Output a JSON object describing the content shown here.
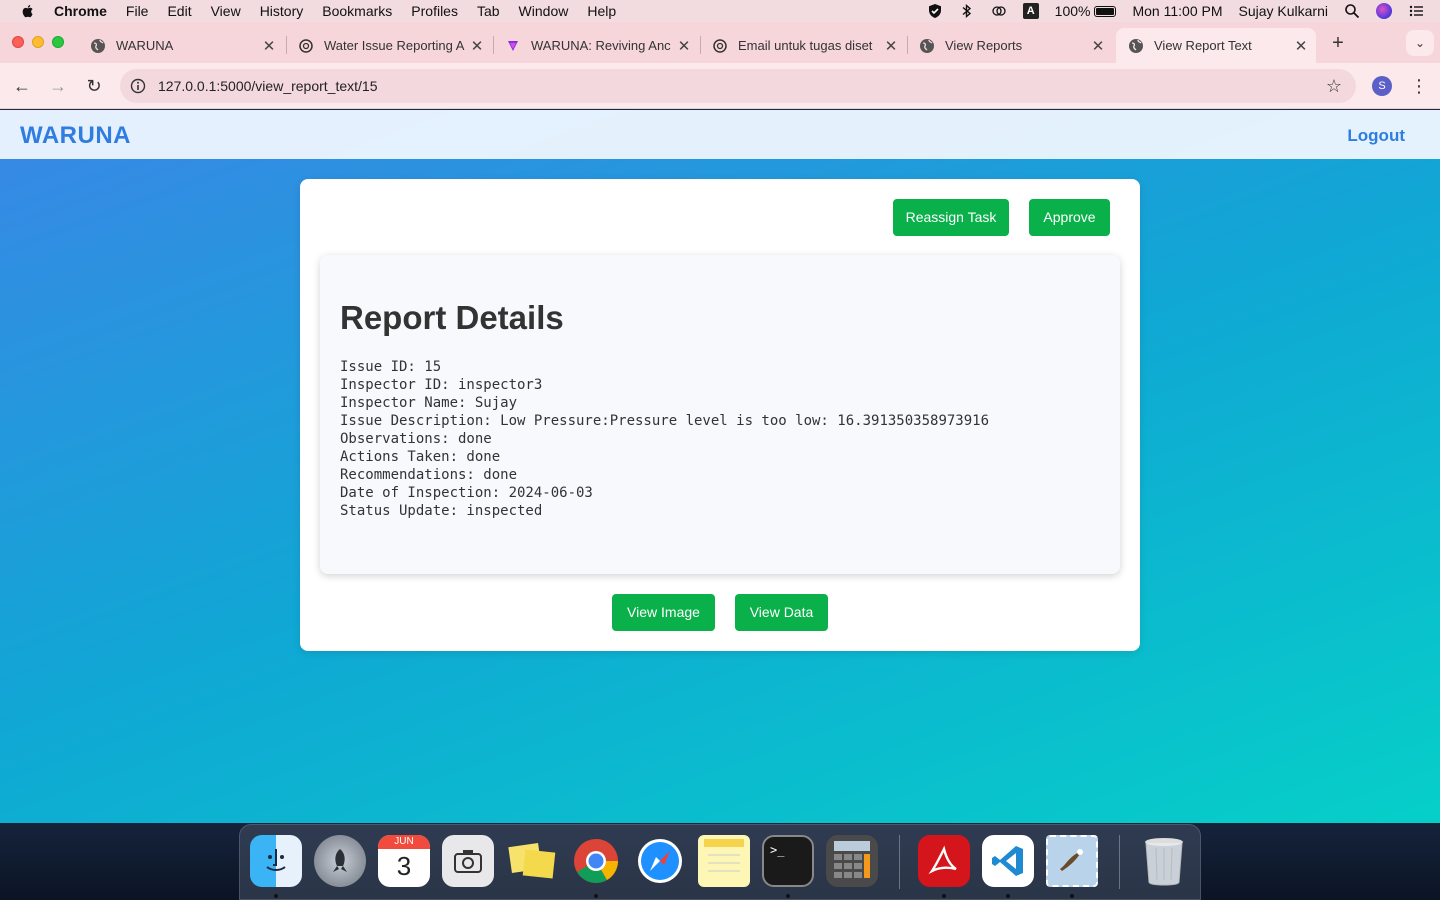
{
  "menubar": {
    "app": "Chrome",
    "items": [
      "File",
      "Edit",
      "View",
      "History",
      "Bookmarks",
      "Profiles",
      "Tab",
      "Window",
      "Help"
    ],
    "battery": "100%",
    "clock": "Mon 11:00 PM",
    "user": "Sujay Kulkarni",
    "input_source": "A"
  },
  "tabs": [
    {
      "title": "WARUNA"
    },
    {
      "title": "Water Issue Reporting A"
    },
    {
      "title": "WARUNA: Reviving Anc"
    },
    {
      "title": "Email untuk tugas diset"
    },
    {
      "title": "View Reports"
    },
    {
      "title": "View Report Text"
    }
  ],
  "address": {
    "url": "127.0.0.1:5000/view_report_text/15",
    "profile_initial": "S"
  },
  "site": {
    "brand": "WARUNA",
    "logout": "Logout"
  },
  "actions": {
    "reassign": "Reassign Task",
    "approve": "Approve",
    "view_image": "View Image",
    "view_data": "View Data"
  },
  "report": {
    "title": "Report Details",
    "lines": [
      "Issue ID: 15",
      "Inspector ID: inspector3",
      "Inspector Name: Sujay",
      "Issue Description: Low Pressure:Pressure level is too low: 16.391350358973916",
      "Observations: done",
      "Actions Taken: done",
      "Recommendations: done",
      "Date of Inspection: 2024-06-03",
      "Status Update: inspected"
    ]
  },
  "dock": {
    "calendar_month": "JUN",
    "calendar_day": "3",
    "apps": [
      "finder",
      "launchpad",
      "calendar",
      "image-capture",
      "stickies",
      "chrome",
      "safari",
      "notes",
      "terminal",
      "calculator",
      "acrobat",
      "vscode",
      "preview",
      "trash"
    ]
  },
  "colors": {
    "accent": "#2f7de1",
    "button": "#0ab04a",
    "tab_strip": "#f6d6db"
  }
}
